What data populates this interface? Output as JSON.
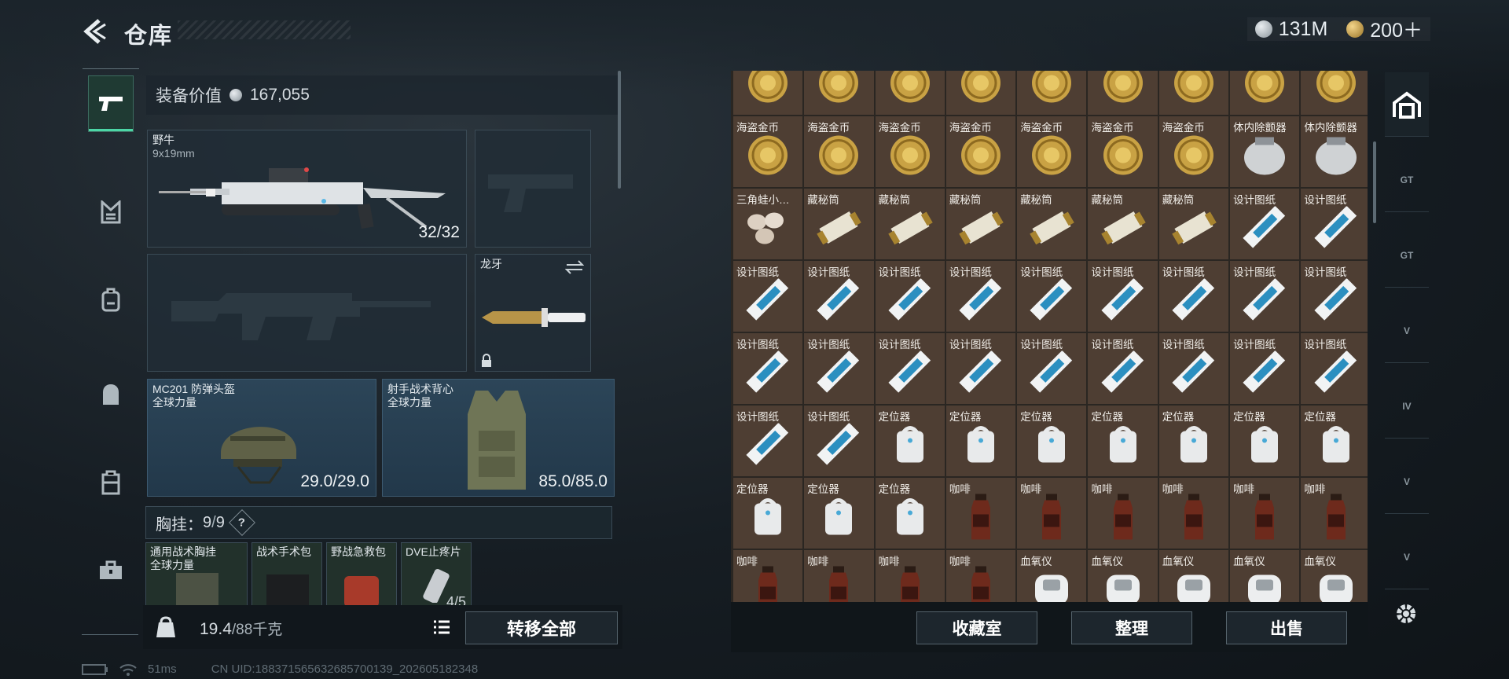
{
  "header": {
    "title": "仓库",
    "currency": [
      {
        "name": "silver-coin",
        "value": "131M"
      },
      {
        "name": "gold-coin",
        "value": "200＋"
      }
    ]
  },
  "equipment": {
    "value_label": "装备价值",
    "value": "167,055",
    "primary": {
      "name": "野牛",
      "caliber": "9x19mm",
      "ammo": "32/32"
    },
    "melee": {
      "name": "龙牙"
    },
    "helmet": {
      "name": "MC201 防弹头盔",
      "brand": "全球力量",
      "durability": "29.0/29.0"
    },
    "armor": {
      "name": "射手战术背心",
      "brand": "全球力量",
      "durability": "85.0/85.0"
    },
    "rig": {
      "label": "胸挂：",
      "used": "9",
      "total": "9",
      "help": "?"
    },
    "rig_items": [
      {
        "name": "通用战术胸挂",
        "brand": "全球力量"
      },
      {
        "name": "战术手术包"
      },
      {
        "name": "野战急救包"
      },
      {
        "name": "DVE止疼片",
        "count": "4/5"
      }
    ]
  },
  "footer_left": {
    "weight": "19.4",
    "weight_max": "/88千克",
    "transfer_label": "转移全部"
  },
  "status": {
    "ping": "51ms",
    "uid": "CN UID:188371565632685700139_202605182348"
  },
  "storage": {
    "items": [
      {
        "label": "",
        "icon": "coin"
      },
      {
        "label": "",
        "icon": "coin"
      },
      {
        "label": "",
        "icon": "coin"
      },
      {
        "label": "",
        "icon": "coin"
      },
      {
        "label": "",
        "icon": "coin"
      },
      {
        "label": "",
        "icon": "coin"
      },
      {
        "label": "",
        "icon": "coin"
      },
      {
        "label": "",
        "icon": "coin"
      },
      {
        "label": "",
        "icon": "coin"
      },
      {
        "label": "海盗金币",
        "icon": "coin"
      },
      {
        "label": "海盗金币",
        "icon": "coin"
      },
      {
        "label": "海盗金币",
        "icon": "coin"
      },
      {
        "label": "海盗金币",
        "icon": "coin"
      },
      {
        "label": "海盗金币",
        "icon": "coin"
      },
      {
        "label": "海盗金币",
        "icon": "coin"
      },
      {
        "label": "海盗金币",
        "icon": "coin"
      },
      {
        "label": "体内除颤器",
        "icon": "defib"
      },
      {
        "label": "体内除颤器",
        "icon": "defib"
      },
      {
        "label": "三角蛙小…",
        "icon": "eggs"
      },
      {
        "label": "藏秘筒",
        "icon": "cryptex"
      },
      {
        "label": "藏秘筒",
        "icon": "cryptex"
      },
      {
        "label": "藏秘筒",
        "icon": "cryptex"
      },
      {
        "label": "藏秘筒",
        "icon": "cryptex"
      },
      {
        "label": "藏秘筒",
        "icon": "cryptex"
      },
      {
        "label": "藏秘筒",
        "icon": "cryptex"
      },
      {
        "label": "设计图纸",
        "icon": "blueprint"
      },
      {
        "label": "设计图纸",
        "icon": "blueprint"
      },
      {
        "label": "设计图纸",
        "icon": "blueprint"
      },
      {
        "label": "设计图纸",
        "icon": "blueprint"
      },
      {
        "label": "设计图纸",
        "icon": "blueprint"
      },
      {
        "label": "设计图纸",
        "icon": "blueprint"
      },
      {
        "label": "设计图纸",
        "icon": "blueprint"
      },
      {
        "label": "设计图纸",
        "icon": "blueprint"
      },
      {
        "label": "设计图纸",
        "icon": "blueprint"
      },
      {
        "label": "设计图纸",
        "icon": "blueprint"
      },
      {
        "label": "设计图纸",
        "icon": "blueprint"
      },
      {
        "label": "设计图纸",
        "icon": "blueprint"
      },
      {
        "label": "设计图纸",
        "icon": "blueprint"
      },
      {
        "label": "设计图纸",
        "icon": "blueprint"
      },
      {
        "label": "设计图纸",
        "icon": "blueprint"
      },
      {
        "label": "设计图纸",
        "icon": "blueprint"
      },
      {
        "label": "设计图纸",
        "icon": "blueprint"
      },
      {
        "label": "设计图纸",
        "icon": "blueprint"
      },
      {
        "label": "设计图纸",
        "icon": "blueprint"
      },
      {
        "label": "设计图纸",
        "icon": "blueprint"
      },
      {
        "label": "设计图纸",
        "icon": "blueprint"
      },
      {
        "label": "设计图纸",
        "icon": "blueprint"
      },
      {
        "label": "定位器",
        "icon": "locator"
      },
      {
        "label": "定位器",
        "icon": "locator"
      },
      {
        "label": "定位器",
        "icon": "locator"
      },
      {
        "label": "定位器",
        "icon": "locator"
      },
      {
        "label": "定位器",
        "icon": "locator"
      },
      {
        "label": "定位器",
        "icon": "locator"
      },
      {
        "label": "定位器",
        "icon": "locator"
      },
      {
        "label": "定位器",
        "icon": "locator"
      },
      {
        "label": "定位器",
        "icon": "locator"
      },
      {
        "label": "定位器",
        "icon": "locator"
      },
      {
        "label": "咖啡",
        "icon": "coffee"
      },
      {
        "label": "咖啡",
        "icon": "coffee"
      },
      {
        "label": "咖啡",
        "icon": "coffee"
      },
      {
        "label": "咖啡",
        "icon": "coffee"
      },
      {
        "label": "咖啡",
        "icon": "coffee"
      },
      {
        "label": "咖啡",
        "icon": "coffee"
      },
      {
        "label": "咖啡",
        "icon": "coffee"
      },
      {
        "label": "咖啡",
        "icon": "coffee"
      },
      {
        "label": "咖啡",
        "icon": "coffee"
      },
      {
        "label": "咖啡",
        "icon": "coffee"
      },
      {
        "label": "血氧仪",
        "icon": "oximeter"
      },
      {
        "label": "血氧仪",
        "icon": "oximeter"
      },
      {
        "label": "血氧仪",
        "icon": "oximeter"
      },
      {
        "label": "血氧仪",
        "icon": "oximeter"
      },
      {
        "label": "血氧仪",
        "icon": "oximeter"
      }
    ]
  },
  "footer_right": {
    "collection": "收藏室",
    "organize": "整理",
    "sell": "出售"
  },
  "right_nav": [
    {
      "icon": "storage-icon",
      "text": ""
    },
    {
      "icon": "gt-expansion-icon",
      "text": "GT"
    },
    {
      "icon": "gt-box-icon",
      "text": "GT"
    },
    {
      "icon": "v-case-icon",
      "text": "V"
    },
    {
      "icon": "iv-case-icon",
      "text": "IV"
    },
    {
      "icon": "v-case-icon",
      "text": "V"
    },
    {
      "icon": "v-case-icon",
      "text": "V"
    }
  ]
}
